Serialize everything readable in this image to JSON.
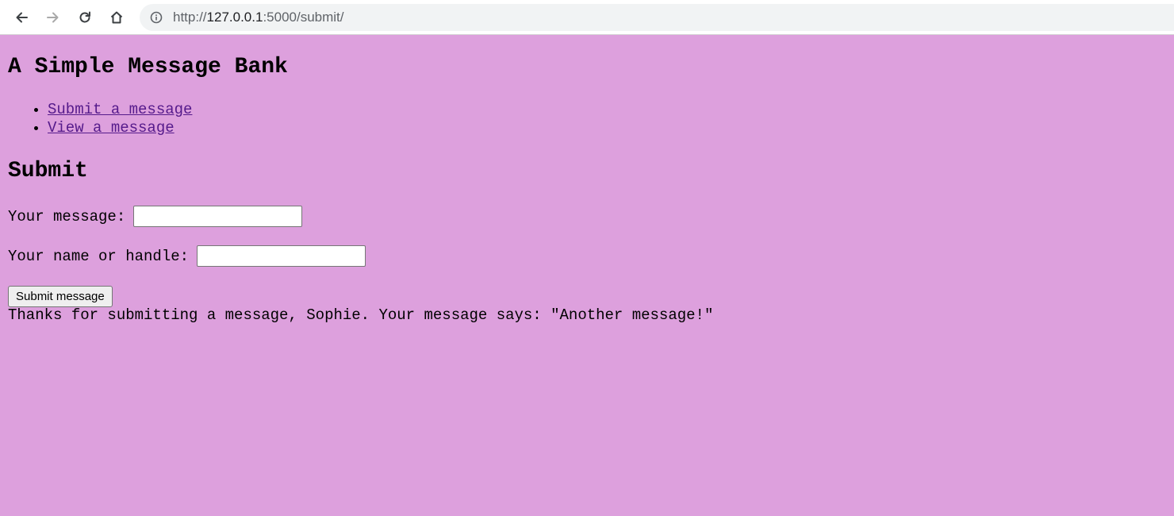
{
  "browser": {
    "url_scheme": "http://",
    "url_host": "127.0.0.1",
    "url_rest": ":5000/submit/"
  },
  "page": {
    "title": "A Simple Message Bank",
    "nav": [
      {
        "label": "Submit a message"
      },
      {
        "label": "View a message"
      }
    ],
    "section_title": "Submit",
    "form": {
      "message_label": "Your message:",
      "message_value": "",
      "name_label": "Your name or handle:",
      "name_value": "",
      "submit_label": "Submit message"
    },
    "confirmation": "Thanks for submitting a message, Sophie. Your message says: \"Another message!\""
  },
  "colors": {
    "page_background": "#dda0dd",
    "link": "#551a8b"
  }
}
